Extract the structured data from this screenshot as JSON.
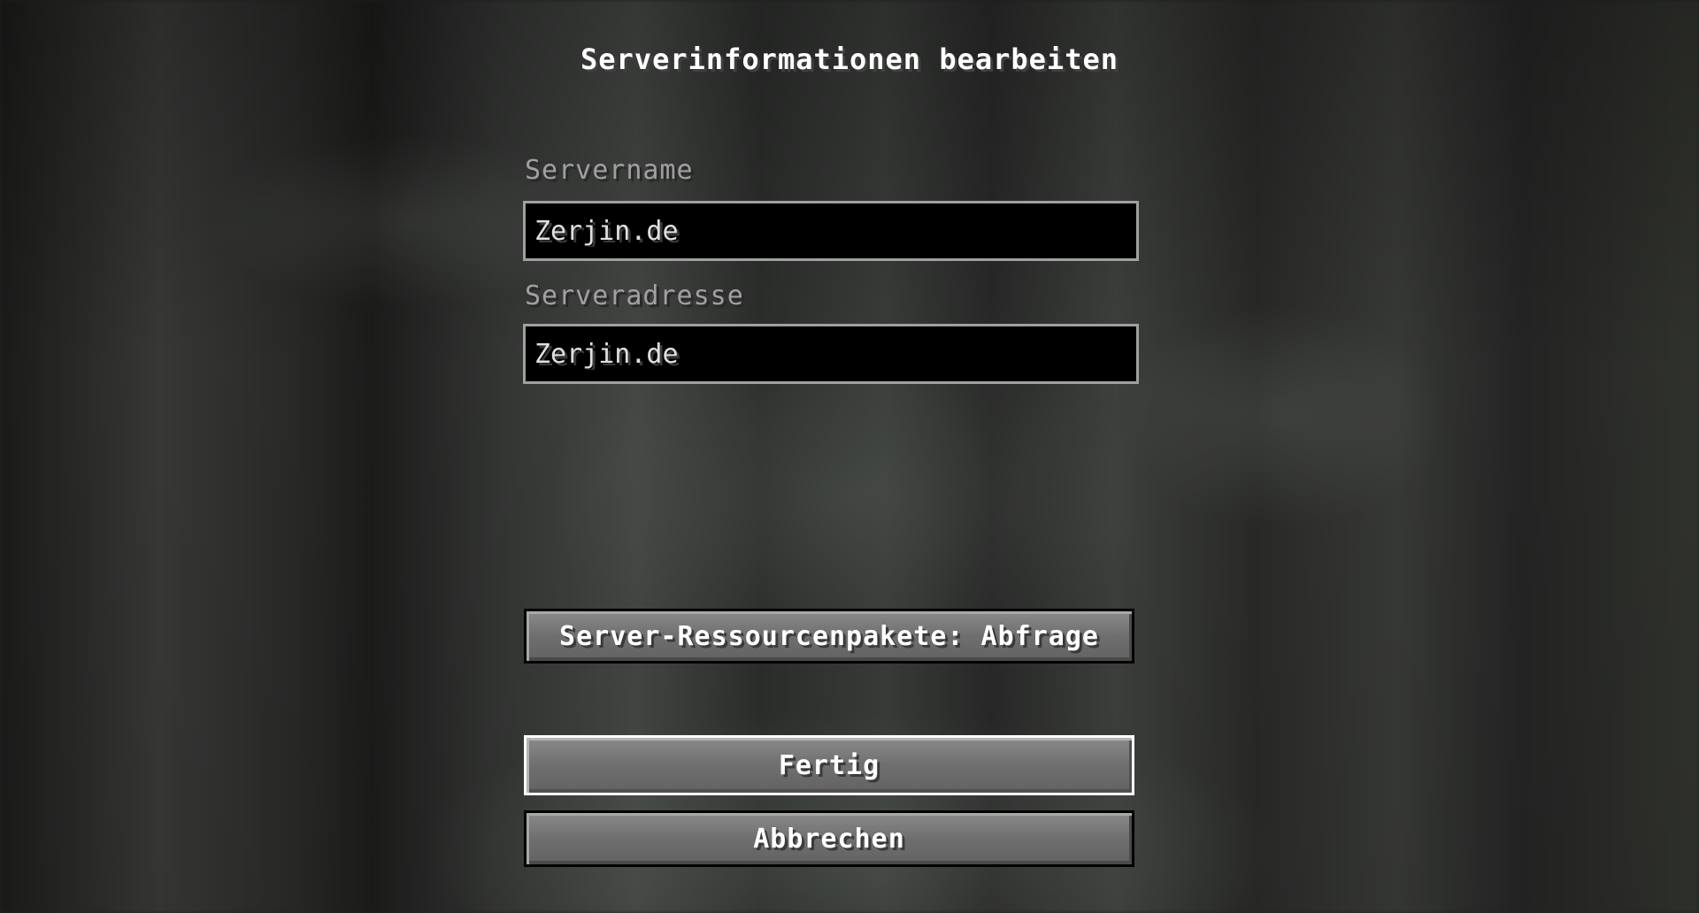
{
  "screen": {
    "title": "Serverinformationen bearbeiten"
  },
  "fields": {
    "server_name": {
      "label": "Servername",
      "value": "Zerjin.de"
    },
    "server_address": {
      "label": "Serveradresse",
      "value": "Zerjin.de"
    }
  },
  "buttons": {
    "resource_packs": "Server-Ressourcenpakete: Abfrage",
    "done": "Fertig",
    "cancel": "Abbrechen"
  },
  "colors": {
    "field_background": "#000000",
    "field_border": "#a0a0a0",
    "label_text": "#a0a0a0",
    "button_face": "#6f6f6f",
    "focused_button_border": "#ffffff"
  }
}
